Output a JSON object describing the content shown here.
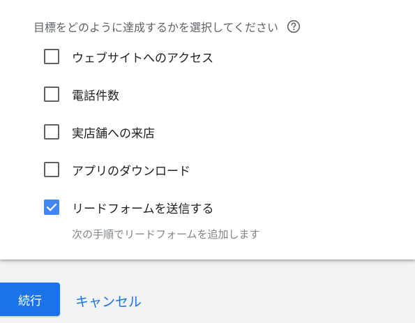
{
  "form": {
    "question": "目標をどのように達成するかを選択してください",
    "help_icon": "help-circle-icon",
    "options": [
      {
        "label": "ウェブサイトへのアクセス",
        "checked": false
      },
      {
        "label": "電話件数",
        "checked": false
      },
      {
        "label": "実店舗への来店",
        "checked": false
      },
      {
        "label": "アプリのダウンロード",
        "checked": false
      },
      {
        "label": "リードフォームを送信する",
        "checked": true
      }
    ],
    "lead_form_note": "次の手順でリードフォームを追加します"
  },
  "footer": {
    "continue_label": "続行",
    "cancel_label": "キャンセル"
  },
  "colors": {
    "primary": "#1a73e8",
    "checkbox_checked": "#4285f4",
    "checkbox_border": "#5f6368",
    "secondary_text": "#5f6368",
    "hint_text": "#80868b",
    "page_background": "#f1f3f4"
  }
}
